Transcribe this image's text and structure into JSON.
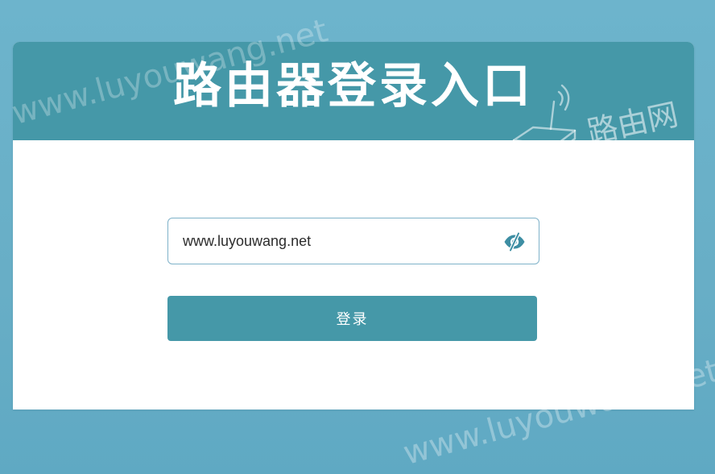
{
  "header": {
    "title": "路由器登录入口"
  },
  "login_form": {
    "password_value": "www.luyouwang.net",
    "login_label": "登录"
  },
  "watermark": {
    "domain_text": "www.luyouwang.net",
    "brand_text": "路由网"
  },
  "colors": {
    "header_bg": "#4598a8",
    "button_bg": "#4598a8",
    "page_bg": "#6db4cc",
    "field_border": "#7fb2c9",
    "eye_icon": "#3d8ea3"
  },
  "icons": {
    "password_toggle": "eye-slash-icon",
    "watermark_logo": "router-logo-icon"
  }
}
